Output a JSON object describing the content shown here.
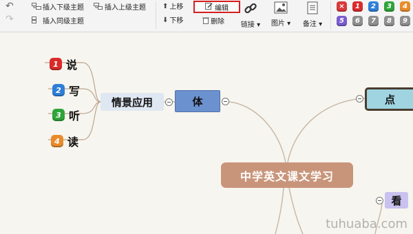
{
  "toolbar": {
    "insert_child": "插入下级主题",
    "insert_parent": "插入上级主题",
    "insert_sibling": "插入同级主题",
    "move_up": "上移",
    "move_down": "下移",
    "edit": "编辑",
    "delete": "删除",
    "link": "链接",
    "image": "图片",
    "note": "备注",
    "markers": [
      {
        "label": "×",
        "color": "#d83a3a"
      },
      {
        "label": "1",
        "color": "#d92b2b"
      },
      {
        "label": "2",
        "color": "#2f7fd8"
      },
      {
        "label": "3",
        "color": "#2fa43a"
      },
      {
        "label": "4",
        "color": "#e98b2a"
      },
      {
        "label": "5",
        "color": "#7a5bd1"
      },
      {
        "label": "6",
        "color": "#8f8f8f"
      },
      {
        "label": "7",
        "color": "#8f8f8f"
      },
      {
        "label": "8",
        "color": "#8f8f8f"
      },
      {
        "label": "9",
        "color": "#8f8f8f"
      }
    ]
  },
  "mindmap": {
    "central": "中学英文课文学习",
    "branch_ti": "体",
    "sub_scene": "情景应用",
    "leaves": [
      {
        "marker": "1",
        "text": "说",
        "color": "#d92b2b"
      },
      {
        "marker": "2",
        "text": "写",
        "color": "#2f7fd8"
      },
      {
        "marker": "3",
        "text": "听",
        "color": "#2fa43a"
      },
      {
        "marker": "4",
        "text": "读",
        "color": "#e98b2a"
      }
    ],
    "branch_dian": "点",
    "branch_kan": "看"
  },
  "watermark": "tuhuaba.com"
}
